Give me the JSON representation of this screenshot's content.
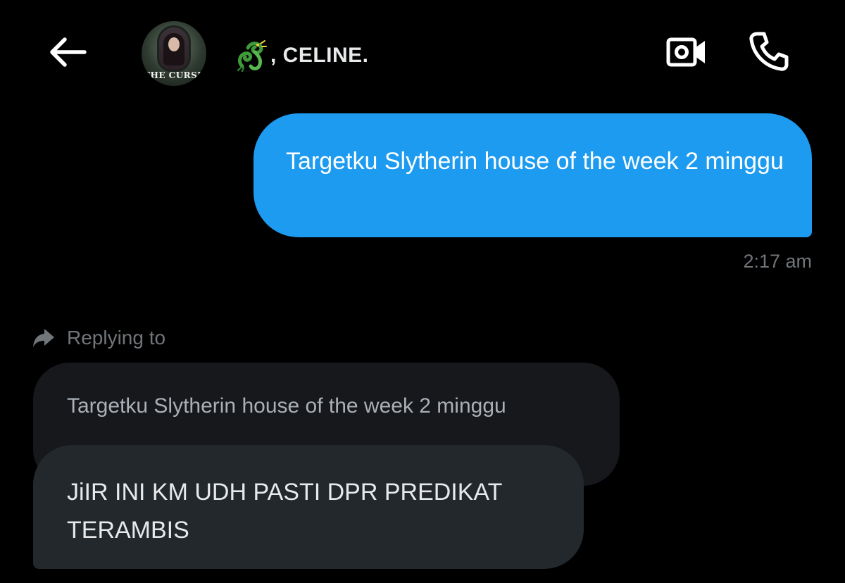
{
  "header": {
    "back_icon": "arrow-left-icon",
    "avatar_caption": "THE CURSE",
    "contact_emoji": "dragon-emoji",
    "contact_name": ", CELINE.",
    "video_icon": "video-camera-icon",
    "call_icon": "phone-icon"
  },
  "messages": {
    "sent": {
      "text": "Targetku Slytherin house of the week 2 minggu",
      "timestamp": "2:17 am",
      "color": "#1d9bf0"
    },
    "received": {
      "replying_to_label": "Replying to",
      "reply_icon": "reply-arrow-icon",
      "quoted_text": "Targetku Slytherin house of the week 2 minggu",
      "text": "JiIR INI KM UDH PASTI DPR PREDIKAT TERAMBIS"
    }
  },
  "colors": {
    "background": "#000000",
    "received_bubble": "#23282d",
    "quoted_bubble": "#16181c",
    "muted_text": "#71767b"
  }
}
